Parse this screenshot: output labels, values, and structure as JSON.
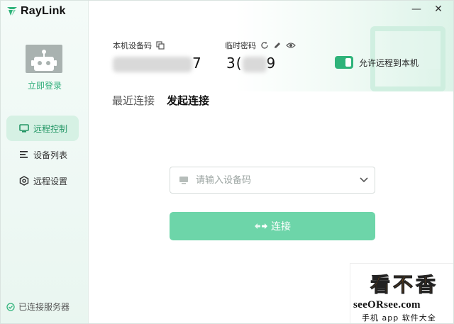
{
  "app": {
    "name": "RayLink",
    "brand_color": "#2fb37a"
  },
  "window": {
    "minimize_label": "—",
    "close_label": "✕"
  },
  "sidebar": {
    "login_label": "立即登录",
    "items": [
      {
        "label": "远程控制",
        "icon": "monitor-icon",
        "active": true
      },
      {
        "label": "设备列表",
        "icon": "list-icon",
        "active": false
      },
      {
        "label": "远程设置",
        "icon": "settings-hex-icon",
        "active": false
      }
    ],
    "status_label": "已连接服务器",
    "status_icon": "check-circle-icon"
  },
  "device_info": {
    "device_code_label": "本机设备码",
    "device_code_visible_suffix": "7",
    "temp_password_label": "临时密码",
    "temp_password_visible_prefix": "3(",
    "temp_password_visible_suffix": "9"
  },
  "allow_remote": {
    "label": "允许远程到本机",
    "enabled": true
  },
  "tabs": [
    {
      "label": "最近连接",
      "active": false
    },
    {
      "label": "发起连接",
      "active": true
    }
  ],
  "connect_form": {
    "placeholder": "请输入设备码",
    "value": "",
    "button_label": "连接"
  },
  "watermark": {
    "chars": [
      "看",
      "不",
      "香"
    ],
    "url": "seeORsee.com",
    "subtitle": "手机 app 软件大全"
  }
}
